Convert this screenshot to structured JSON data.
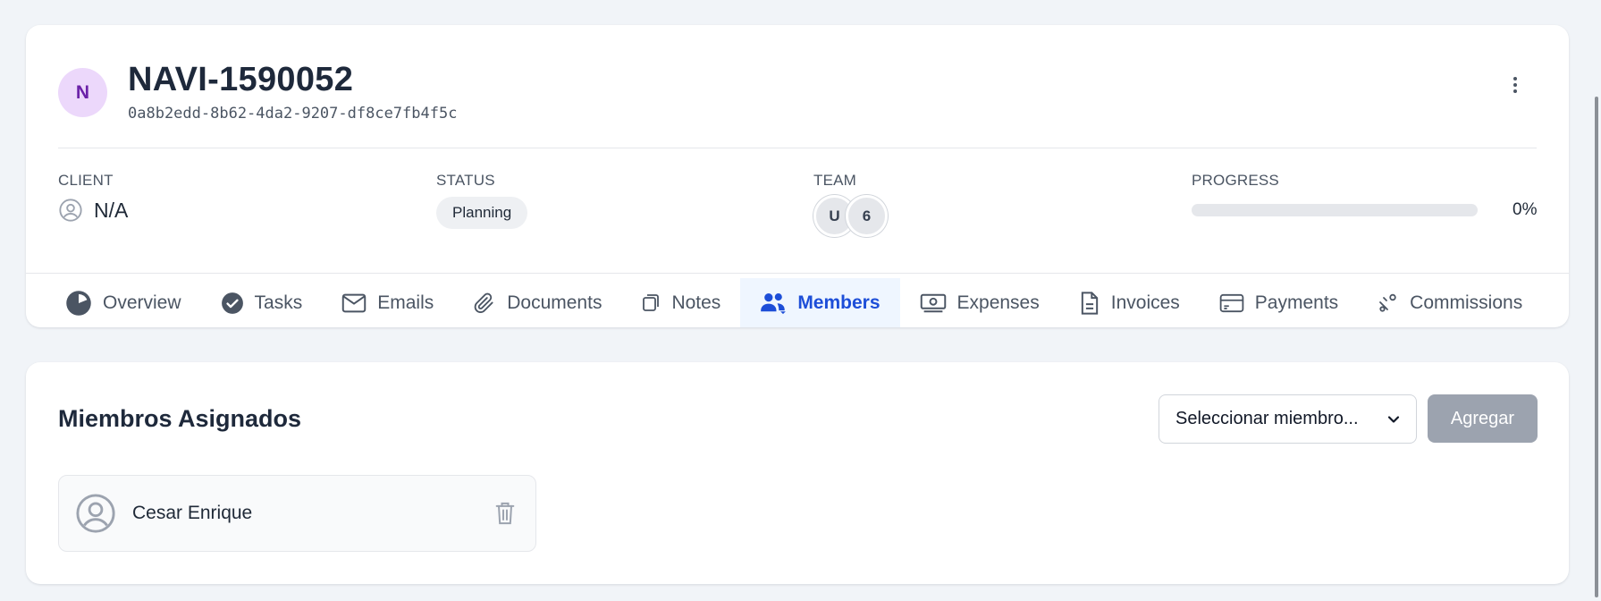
{
  "project": {
    "avatar_initial": "N",
    "title": "NAVI-1590052",
    "id": "0a8b2edd-8b62-4da2-9207-df8ce7fb4f5c"
  },
  "info": {
    "client_label": "CLIENT",
    "client_value": "N/A",
    "status_label": "STATUS",
    "status_value": "Planning",
    "team_label": "TEAM",
    "team_avatars": [
      "U",
      "6"
    ],
    "progress_label": "PROGRESS",
    "progress_text": "0%",
    "progress_value": 0
  },
  "tabs": [
    {
      "label": "Overview",
      "icon": "pie-chart-icon"
    },
    {
      "label": "Tasks",
      "icon": "check-circle-icon"
    },
    {
      "label": "Emails",
      "icon": "envelope-icon"
    },
    {
      "label": "Documents",
      "icon": "paperclip-icon"
    },
    {
      "label": "Notes",
      "icon": "notes-icon"
    },
    {
      "label": "Members",
      "icon": "users-icon",
      "active": true
    },
    {
      "label": "Expenses",
      "icon": "money-icon"
    },
    {
      "label": "Invoices",
      "icon": "document-icon"
    },
    {
      "label": "Payments",
      "icon": "credit-card-icon"
    },
    {
      "label": "Commissions",
      "icon": "percent-icon"
    }
  ],
  "members_section": {
    "title": "Miembros Asignados",
    "select_placeholder": "Seleccionar miembro...",
    "add_label": "Agregar",
    "members": [
      {
        "name": "Cesar Enrique"
      }
    ]
  },
  "colors": {
    "accent": "#1d4ed8",
    "avatar_bg": "#ecd8fb",
    "avatar_fg": "#6b21a8",
    "disabled_button": "#9ca3af"
  }
}
